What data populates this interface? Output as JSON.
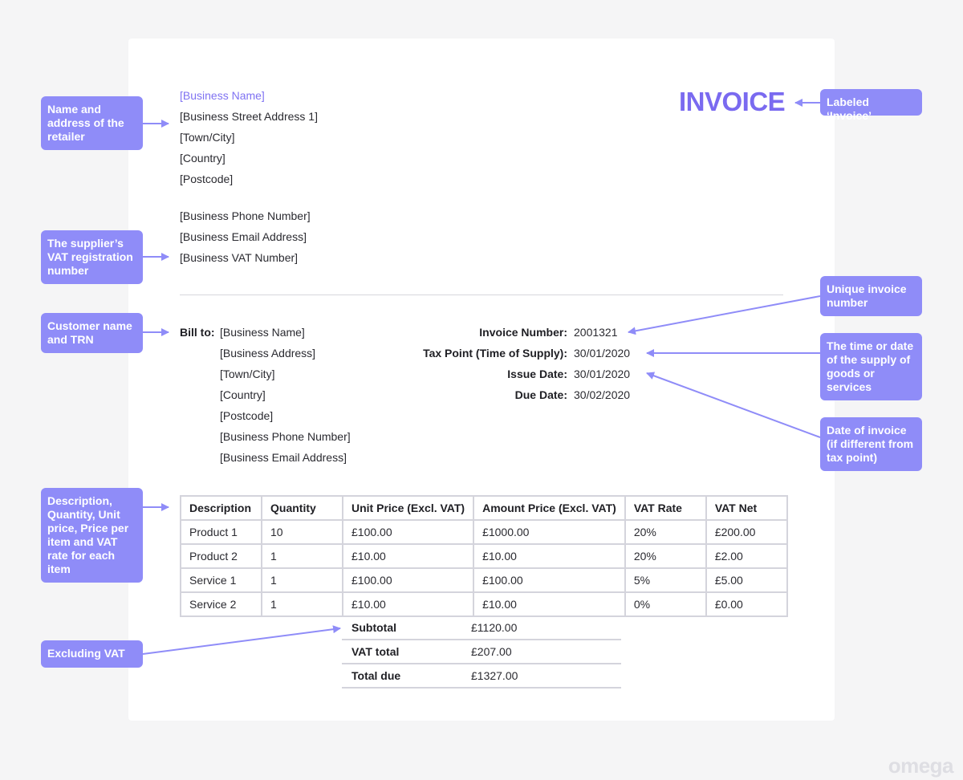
{
  "invoice": {
    "title": "INVOICE",
    "business": {
      "name": "[Business Name]",
      "address_lines": [
        "[Business Street Address 1]",
        "[Town/City]",
        "[Country]",
        "[Postcode]"
      ],
      "contact_lines": [
        "[Business Phone Number]",
        "[Business Email Address]",
        "[Business VAT Number]"
      ]
    },
    "bill_to": {
      "label": "Bill to:",
      "lines": [
        "[Business Name]",
        "[Business Address]",
        "[Town/City]",
        "[Country]",
        "[Postcode]",
        "[Business Phone Number]",
        "[Business Email Address]"
      ]
    },
    "meta": [
      {
        "label": "Invoice Number:",
        "value": "2001321"
      },
      {
        "label": "Tax Point (Time of Supply):",
        "value": "30/01/2020"
      },
      {
        "label": "Issue Date:",
        "value": "30/01/2020"
      },
      {
        "label": "Due Date:",
        "value": "30/02/2020"
      }
    ],
    "table": {
      "headers": [
        "Description",
        "Quantity",
        "Unit Price (Excl. VAT)",
        "Amount Price (Excl. VAT)",
        "VAT Rate",
        "VAT Net"
      ],
      "rows": [
        [
          "Product 1",
          "10",
          "£100.00",
          "£1000.00",
          "20%",
          "£200.00"
        ],
        [
          "Product 2",
          "1",
          "£10.00",
          "£10.00",
          "20%",
          "£2.00"
        ],
        [
          "Service 1",
          "1",
          "£100.00",
          "£100.00",
          "5%",
          "£5.00"
        ],
        [
          "Service 2",
          "1",
          "£10.00",
          "£10.00",
          "0%",
          "£0.00"
        ]
      ]
    },
    "totals": [
      {
        "label": "Subtotal",
        "value": "£1120.00"
      },
      {
        "label": "VAT total",
        "value": "£207.00"
      },
      {
        "label": "Total due",
        "value": "£1327.00"
      }
    ]
  },
  "callouts": {
    "retailer": "Name and address of the retailer",
    "vat_number": "The supplier’s VAT registration number",
    "customer": "Customer name and TRN",
    "line_items": "Description, Quantity, Unit price, Price per item and VAT rate for each item",
    "excluding_vat": "Excluding VAT",
    "invoice_label": "Labeled ‘Invoice’",
    "invoice_number": "Unique invoice number",
    "tax_point": "The time or date of the supply of goods or services",
    "issue_date": "Date of invoice (if different from tax point)"
  },
  "brand": "omega",
  "colors": {
    "accent": "#7a6af0",
    "callout_bg": "#8f8cf8",
    "arrow": "#8f8cf8",
    "border": "#d4d4dc",
    "page_bg": "#f5f5f6"
  }
}
